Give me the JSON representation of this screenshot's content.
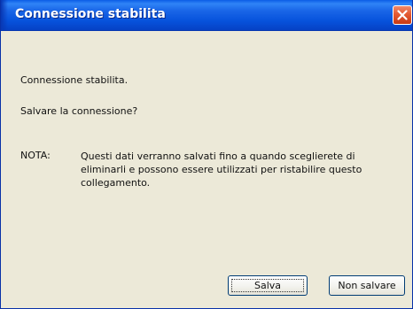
{
  "window": {
    "title": "Connessione stabilita",
    "close_icon": "close-icon"
  },
  "message": {
    "line1": "Connessione stabilita.",
    "line2": "Salvare la connessione?",
    "note_label": "NOTA:",
    "note_text": "Questi dati verranno salvati fino a quando sceglierete di eliminarli e possono essere utilizzati per ristabilire questo collegamento."
  },
  "buttons": {
    "save_label": "Salva",
    "no_save_label": "Non salvare"
  },
  "colors": {
    "titlebar": "#0a5ce6",
    "client_area": "#ece9d8",
    "close_button": "#e45a32"
  }
}
